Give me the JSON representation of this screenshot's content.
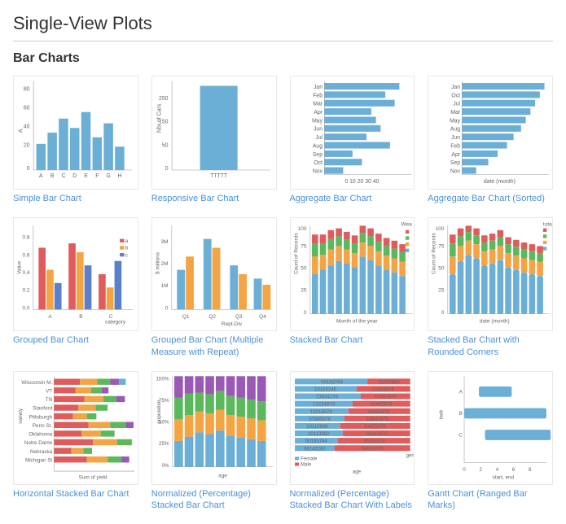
{
  "page": {
    "title": "Single-View Plots",
    "section": "Bar Charts"
  },
  "charts": [
    {
      "id": "simple-bar",
      "label": "Simple Bar Chart",
      "type": "simple-bar"
    },
    {
      "id": "responsive-bar",
      "label": "Responsive Bar Chart",
      "type": "responsive-bar"
    },
    {
      "id": "aggregate-bar",
      "label": "Aggregate Bar Chart",
      "type": "aggregate-bar"
    },
    {
      "id": "aggregate-bar-sorted",
      "label": "Aggregate Bar Chart (Sorted)",
      "type": "aggregate-bar-sorted"
    },
    {
      "id": "grouped-bar",
      "label": "Grouped Bar Chart",
      "type": "grouped-bar"
    },
    {
      "id": "grouped-bar-multiple",
      "label": "Grouped Bar Chart (Multiple Measure with Repeat)",
      "type": "grouped-bar-multiple"
    },
    {
      "id": "stacked-bar",
      "label": "Stacked Bar Chart",
      "type": "stacked-bar"
    },
    {
      "id": "stacked-bar-rounded",
      "label": "Stacked Bar Chart with Rounded Corners",
      "type": "stacked-bar-rounded"
    },
    {
      "id": "horizontal-stacked",
      "label": "Horizontal Stacked Bar Chart",
      "type": "horizontal-stacked"
    },
    {
      "id": "normalized-stacked",
      "label": "Normalized (Percentage) Stacked Bar Chart",
      "type": "normalized-stacked"
    },
    {
      "id": "normalized-stacked-labels",
      "label": "Normalized (Percentage) Stacked Bar Chart With Labels",
      "type": "normalized-stacked-labels"
    },
    {
      "id": "gantt",
      "label": "Gantt Chart (Ranged Bar Marks)",
      "type": "gantt"
    }
  ]
}
